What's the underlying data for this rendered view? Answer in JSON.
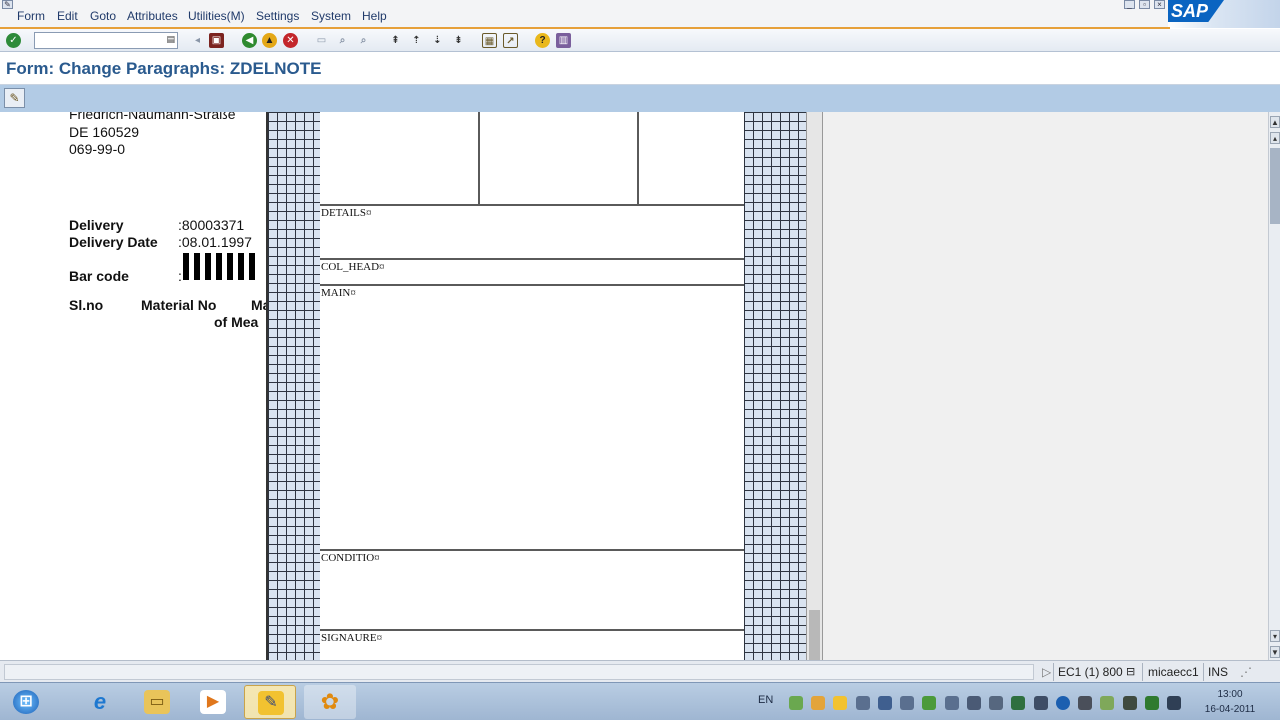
{
  "menu": {
    "items": [
      "Form",
      "Edit",
      "Goto",
      "Attributes",
      "Utilities(M)",
      "Settings",
      "System",
      "Help"
    ]
  },
  "sap_logo": "SAP",
  "toolbar": {
    "command_value": "",
    "icons": [
      "enter-icon",
      "save-icon",
      "back-icon",
      "exit-icon",
      "cancel-icon",
      "print-icon",
      "find-icon",
      "find-next-icon",
      "first-page-icon",
      "prev-page-icon",
      "next-page-icon",
      "last-page-icon",
      "new-session-icon",
      "shortcut-icon",
      "help-icon",
      "layout-icon"
    ]
  },
  "title": "Form: Change Paragraphs: ZDELNOTE",
  "preview": {
    "address_line_cut": "Friedrich-Naumann-Straße",
    "postal_line": "DE 160529",
    "phone": "069-99-0",
    "delivery_label": "Delivery",
    "delivery_value": ":80003371",
    "delivery_date_label": "Delivery Date",
    "delivery_date_value": ":08.01.1997",
    "barcode_label": "Bar code",
    "barcode_colon": ":",
    "col_slno": "Sl.no",
    "col_material_no": "Material No",
    "col_ma": "Ma",
    "col_of_mea": "of Mea"
  },
  "form_windows": [
    "DETAILS¤",
    "COL_HEAD¤",
    "MAIN¤",
    "CONDITIO¤",
    "SIGNAURE¤"
  ],
  "status": {
    "system": "EC1 (1) 800",
    "server": "micaecc1",
    "mode": "INS"
  },
  "taskbar": {
    "language": "EN",
    "time": "13:00",
    "date": "16-04-2011"
  },
  "colors": {
    "title": "#2a5a8e",
    "accent": "#e6a03a",
    "app_toolbar": "#b2cbe5",
    "grid": "#d9e3f0"
  }
}
